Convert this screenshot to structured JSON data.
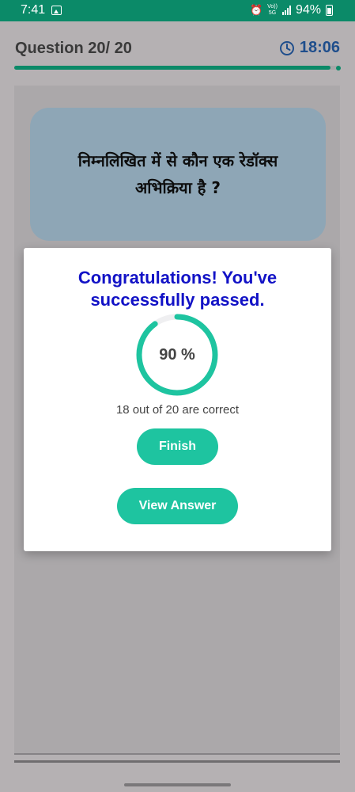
{
  "status_bar": {
    "time": "7:41",
    "volte_top": "Vo))",
    "volte_bottom": "5G",
    "battery_level": "94%"
  },
  "header": {
    "question_counter": "Question 20/ 20",
    "timer": "18:06",
    "progress_fraction": 0.97
  },
  "question": {
    "text": "निम्नलिखित में से कौन एक रेडॉक्स अभिक्रिया है ?"
  },
  "result_dialog": {
    "title": "Congratulations! You've successfully passed.",
    "score_percent": 90,
    "score_label": "90 %",
    "score_text": "18 out of 20 are correct",
    "finish_label": "Finish",
    "view_answer_label": "View Answer"
  },
  "colors": {
    "status_bar": "#0b8a68",
    "accent": "#1ec4a0",
    "title": "#1212c6",
    "timer": "#1f4e8c"
  },
  "icons": [
    "gallery-icon",
    "alarm-icon",
    "signal-icon",
    "battery-icon",
    "clock-icon"
  ]
}
